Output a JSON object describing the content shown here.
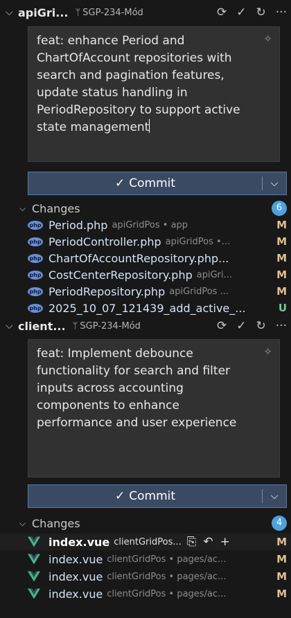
{
  "repos": [
    {
      "name": "apiGri...",
      "branch": "SGP-234-Mód",
      "commit_message": "feat: enhance Period and ChartOfAccount repositories with search and pagination features, update status handling in PeriodRepository to support active state management",
      "commit_label": "Commit",
      "changes_label": "Changes",
      "changes_count": "6",
      "files": [
        {
          "name": "Period.php",
          "desc": "apiGridPos • app",
          "status": "M",
          "icon": "php-icon"
        },
        {
          "name": "PeriodController.php",
          "desc": "apiGridPos •...",
          "status": "M",
          "icon": "php-icon"
        },
        {
          "name": "ChartOfAccountRepository.php...",
          "desc": "",
          "status": "M",
          "icon": "php-icon"
        },
        {
          "name": "CostCenterRepository.php",
          "desc": "apiGri...",
          "status": "M",
          "icon": "php-icon"
        },
        {
          "name": "PeriodRepository.php",
          "desc": "apiGridPos ...",
          "status": "M",
          "icon": "php-icon"
        },
        {
          "name": "2025_10_07_121439_add_active_...",
          "desc": "",
          "status": "U",
          "icon": "php-icon"
        }
      ]
    },
    {
      "name": "client...",
      "branch": "SGP-234-Mód",
      "commit_message": "feat: Implement debounce functionality for search and filter inputs across accounting components to enhance performance and user experience",
      "commit_label": "Commit",
      "changes_label": "Changes",
      "changes_count": "4",
      "files": [
        {
          "name": "index.vue",
          "desc": "clientGridPos...",
          "status": "M",
          "icon": "vue-icon"
        },
        {
          "name": "index.vue",
          "desc": "clientGridPos • pages/ac...",
          "status": "M",
          "icon": "vue-icon"
        },
        {
          "name": "index.vue",
          "desc": "clientGridPos • pages/ac...",
          "status": "M",
          "icon": "vue-icon"
        },
        {
          "name": "index.vue",
          "desc": "clientGridPos • pages/ac...",
          "status": "M",
          "icon": "vue-icon"
        }
      ]
    }
  ],
  "colors": {
    "background": "#181818",
    "commit_button": "#3b4a63",
    "badge": "#4aa3df",
    "modified": "#e2c08d",
    "untracked": "#73c991"
  }
}
